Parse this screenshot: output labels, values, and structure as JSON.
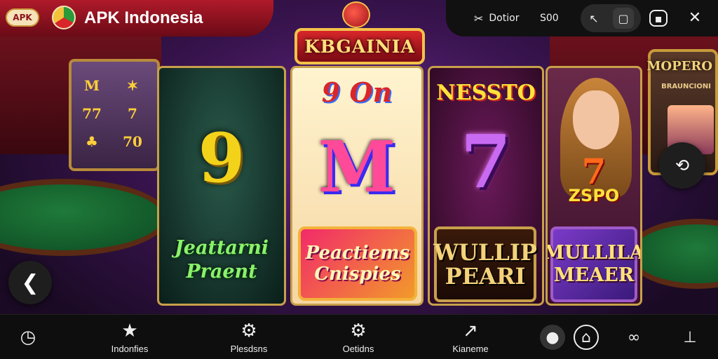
{
  "header": {
    "logo_text": "APK",
    "title": "APK Indonesia",
    "right": {
      "label_left": "Dotior",
      "value": "S00"
    }
  },
  "banner": {
    "title": "KBGAINIA"
  },
  "reels": [
    {
      "symbol": "9",
      "label": "Jeattarni Praent"
    },
    {
      "top": "9 On",
      "symbol": "M",
      "label": "Peactiems Cnispies"
    },
    {
      "top": "NESSTO",
      "symbol": "7",
      "label": "WULLIP PEARI"
    },
    {
      "symbol": "7",
      "sublabel": "ZSPO",
      "label": "MULLILA MEAER"
    }
  ],
  "background": {
    "slot_cells": [
      "M",
      "✶",
      "77",
      "7",
      "♣",
      "70"
    ],
    "machine_title": "MOPERO",
    "machine_sub": "BRAUNCIONI"
  },
  "bottom_nav": [
    {
      "label": "",
      "icon": "timer-icon"
    },
    {
      "label": "Indonfies",
      "icon": "star-icon"
    },
    {
      "label": "Plesdsns",
      "icon": "gear-icon"
    },
    {
      "label": "Oetidns",
      "icon": "gear-icon"
    },
    {
      "label": "Kianeme",
      "icon": "chart-icon"
    }
  ],
  "colors": {
    "header_red": "#b01a2a",
    "reel_border": "#c8a04a",
    "nav_bg": "#0e0e0e"
  }
}
